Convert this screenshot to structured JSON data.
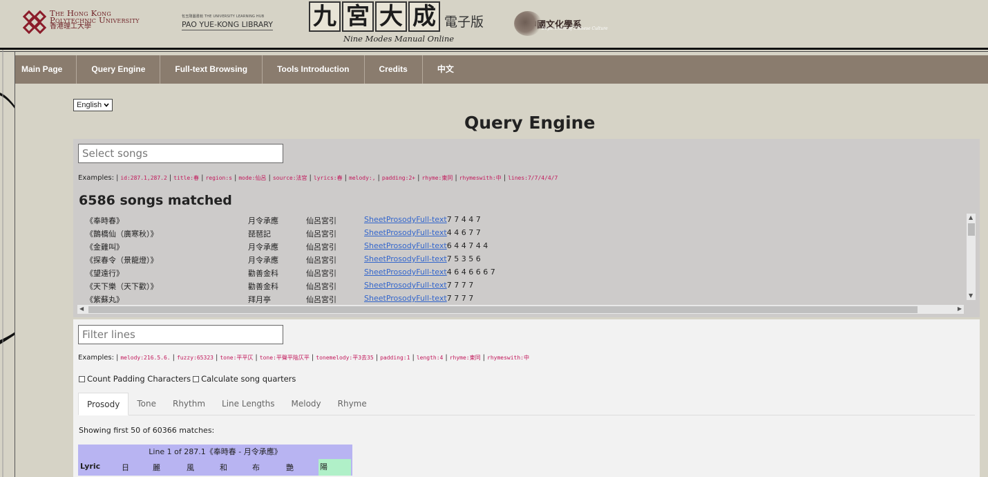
{
  "header": {
    "polyu": {
      "line1": "The Hong Kong",
      "line2": "Polytechnic University",
      "zh": "香港理工大學"
    },
    "library": {
      "small": "包玉剛圖書館  THE UNIVERSITY LEARNING HUB",
      "name": "PAO YUE-KONG LIBRARY"
    },
    "title": {
      "chars": [
        "九",
        "宮",
        "大",
        "成"
      ],
      "sub": "電子版",
      "en": "Nine Modes Manual Online"
    },
    "dept": {
      "zh": "中國文化學系",
      "en": "Department of Chinese Culture"
    }
  },
  "nav": [
    {
      "label": "Main Page"
    },
    {
      "label": "Query Engine"
    },
    {
      "label": "Full-text Browsing"
    },
    {
      "label": "Tools Introduction"
    },
    {
      "label": "Credits"
    },
    {
      "label": "中文"
    }
  ],
  "language": {
    "selected": "English"
  },
  "page_title": "Query Engine",
  "songs": {
    "placeholder": "Select songs",
    "examples_label": "Examples:",
    "examples": [
      "id:287.1,287.2",
      "title:春",
      "region:s",
      "mode:仙呂",
      "source:法宮",
      "lyrics:春",
      "melody:,",
      "padding:2+",
      "rhyme:東同",
      "rhymeswith:中",
      "lines:7/7/4/4/7"
    ],
    "matched": "6586 songs matched",
    "rows": [
      {
        "title": "《奉時春》",
        "source": "月令承應",
        "mode": "仙呂宮引",
        "sheet": "Sheet",
        "prosody": "Prosody",
        "fulltext": "Full-text",
        "lines": "7 7 4 4 7"
      },
      {
        "title": "《鵲橋仙（廣寒秋）》",
        "source": "琵琶記",
        "mode": "仙呂宮引",
        "sheet": "Sheet",
        "prosody": "Prosody",
        "fulltext": "Full-text",
        "lines": "4 4 6 7 7"
      },
      {
        "title": "《金雞叫》",
        "source": "月令承應",
        "mode": "仙呂宮引",
        "sheet": "Sheet",
        "prosody": "Prosody",
        "fulltext": "Full-text",
        "lines": "6 4 4 7 4 4"
      },
      {
        "title": "《探春令（景龍燈）》",
        "source": "月令承應",
        "mode": "仙呂宮引",
        "sheet": "Sheet",
        "prosody": "Prosody",
        "fulltext": "Full-text",
        "lines": "7 5 3 5 6"
      },
      {
        "title": "《望遠行》",
        "source": "勸善金科",
        "mode": "仙呂宮引",
        "sheet": "Sheet",
        "prosody": "Prosody",
        "fulltext": "Full-text",
        "lines": "4 6 4 6 6 6 7"
      },
      {
        "title": "《天下樂（天下歡）》",
        "source": "勸善金科",
        "mode": "仙呂宮引",
        "sheet": "Sheet",
        "prosody": "Prosody",
        "fulltext": "Full-text",
        "lines": "7 7 7 7"
      },
      {
        "title": "《紫蘇丸》",
        "source": "拜月亭",
        "mode": "仙呂宮引",
        "sheet": "Sheet",
        "prosody": "Prosody",
        "fulltext": "Full-text",
        "lines": "7 7 7 7"
      }
    ]
  },
  "lines": {
    "placeholder": "Filter lines",
    "examples_label": "Examples:",
    "examples": [
      "melody:216.5.6.",
      "fuzzy:65323",
      "tone:平平仄",
      "tone:平聲平陰仄平",
      "tonemelody:平3去35",
      "padding:1",
      "length:4",
      "rhyme:東同",
      "rhymeswith:中"
    ],
    "check_padding": "Count Padding Characters",
    "check_quarters": "Calculate song quarters",
    "tabs": [
      {
        "label": "Prosody"
      },
      {
        "label": "Tone"
      },
      {
        "label": "Rhythm"
      },
      {
        "label": "Line Lengths"
      },
      {
        "label": "Melody"
      },
      {
        "label": "Rhyme"
      }
    ],
    "showing": "Showing first 50 of 60366 matches:",
    "result": {
      "head": "Line 1 of 287.1《奉時春 - 月令承應》",
      "row_label": "Lyric",
      "chars": [
        "日",
        "麗",
        "風",
        "和",
        "布",
        "艷",
        "陽"
      ]
    }
  },
  "colors": {
    "nav_bg": "#8a7c6e",
    "page_bg": "#d6d3c6",
    "link": "#3366cc",
    "code": "#c2185b",
    "result_bg": "#b8b4f2",
    "highlight": "#b0f0c8"
  }
}
